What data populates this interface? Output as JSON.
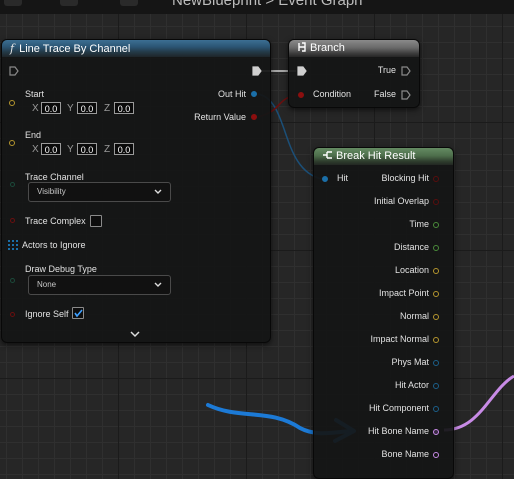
{
  "breadcrumb": {
    "text": "NewBlueprint > Event Graph"
  },
  "line_trace": {
    "title": "Line Trace By Channel",
    "title_icon": "f",
    "start_label": "Start",
    "end_label": "End",
    "start": {
      "x": "0.0",
      "y": "0.0",
      "z": "0.0"
    },
    "end": {
      "x": "0.0",
      "y": "0.0",
      "z": "0.0"
    },
    "axis_x": "X",
    "axis_y": "Y",
    "axis_z": "Z",
    "trace_channel_label": "Trace Channel",
    "trace_channel_value": "Visibility",
    "trace_complex_label": "Trace Complex",
    "actors_to_ignore_label": "Actors to Ignore",
    "draw_debug_type_label": "Draw Debug Type",
    "draw_debug_type_value": "None",
    "ignore_self_label": "Ignore Self",
    "out_hit_label": "Out Hit",
    "return_value_label": "Return Value"
  },
  "branch": {
    "title": "Branch",
    "condition_label": "Condition",
    "true_label": "True",
    "false_label": "False"
  },
  "break_hit": {
    "title": "Break Hit Result",
    "hit_label": "Hit",
    "outputs": [
      "Blocking Hit",
      "Initial Overlap",
      "Time",
      "Distance",
      "Location",
      "Impact Point",
      "Normal",
      "Impact Normal",
      "Phys Mat",
      "Hit Actor",
      "Hit Component",
      "Hit Bone Name",
      "Bone Name"
    ]
  },
  "colors": {
    "bool_pin": "#8c0f0f",
    "float_pin": "#7ec35a",
    "vector_pin": "#c3a43a",
    "struct_pin": "#1b6fa8",
    "name_pin": "#c88be6",
    "annotation_arrow": "#1c7ad6"
  }
}
